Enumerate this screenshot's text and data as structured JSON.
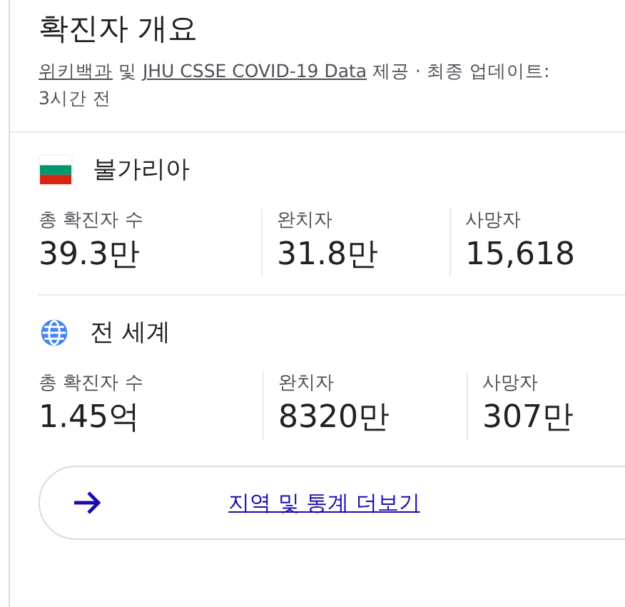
{
  "title": "확진자 개요",
  "source": {
    "parts": [
      {
        "kind": "link",
        "text": "위키백과"
      },
      {
        "kind": "text",
        "text": " 및 "
      },
      {
        "kind": "link",
        "text": "JHU CSSE COVID-19 Data"
      },
      {
        "kind": "text",
        "text": " 제공 · 최종 업데이트:"
      }
    ],
    "time": "3시간 전"
  },
  "regions": [
    {
      "kind": "flag",
      "name": "불가리아",
      "stats": [
        {
          "label": "총 확진자 수",
          "value": "39.3만"
        },
        {
          "label": "완치자",
          "value": "31.8만"
        },
        {
          "label": "사망자",
          "value": "15,618"
        }
      ]
    },
    {
      "kind": "globe",
      "name": "전 세계",
      "stats": [
        {
          "label": "총 확진자 수",
          "value": "1.45억"
        },
        {
          "label": "완치자",
          "value": "8320만"
        },
        {
          "label": "사망자",
          "value": "307만"
        }
      ]
    }
  ],
  "more_button": {
    "label": "지역 및 통계 더보기"
  }
}
